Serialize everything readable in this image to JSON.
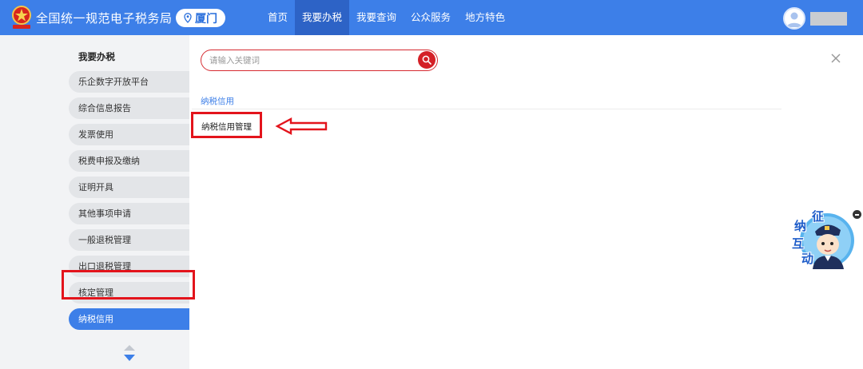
{
  "header": {
    "site_title": "全国统一规范电子税务局",
    "city": "厦门",
    "nav": [
      {
        "label": "首页",
        "active": false
      },
      {
        "label": "我要办税",
        "active": true
      },
      {
        "label": "我要查询",
        "active": false
      },
      {
        "label": "公众服务",
        "active": false
      },
      {
        "label": "地方特色",
        "active": false
      }
    ],
    "icons": {
      "emblem": "tax-emblem-icon",
      "location": "map-pin-icon",
      "avatar": "user-avatar-icon"
    }
  },
  "sidebar": {
    "title": "我要办税",
    "items": [
      {
        "label": "乐企数字开放平台",
        "active": false
      },
      {
        "label": "综合信息报告",
        "active": false
      },
      {
        "label": "发票使用",
        "active": false
      },
      {
        "label": "税费申报及缴纳",
        "active": false
      },
      {
        "label": "证明开具",
        "active": false
      },
      {
        "label": "其他事项申请",
        "active": false
      },
      {
        "label": "一般退税管理",
        "active": false
      },
      {
        "label": "出口退税管理",
        "active": false
      },
      {
        "label": "核定管理",
        "active": false
      },
      {
        "label": "纳税信用",
        "active": true
      }
    ]
  },
  "search": {
    "placeholder": "请输入关键词",
    "value": ""
  },
  "results": {
    "category": "纳税信用",
    "items": [
      "纳税信用管理"
    ]
  },
  "helper": {
    "chars": [
      "征",
      "纳",
      "互",
      "动"
    ]
  },
  "colors": {
    "primary": "#3d7fe8",
    "nav_active": "#2d63c6",
    "annotation_red": "#e3141c",
    "search_red": "#d42027"
  }
}
